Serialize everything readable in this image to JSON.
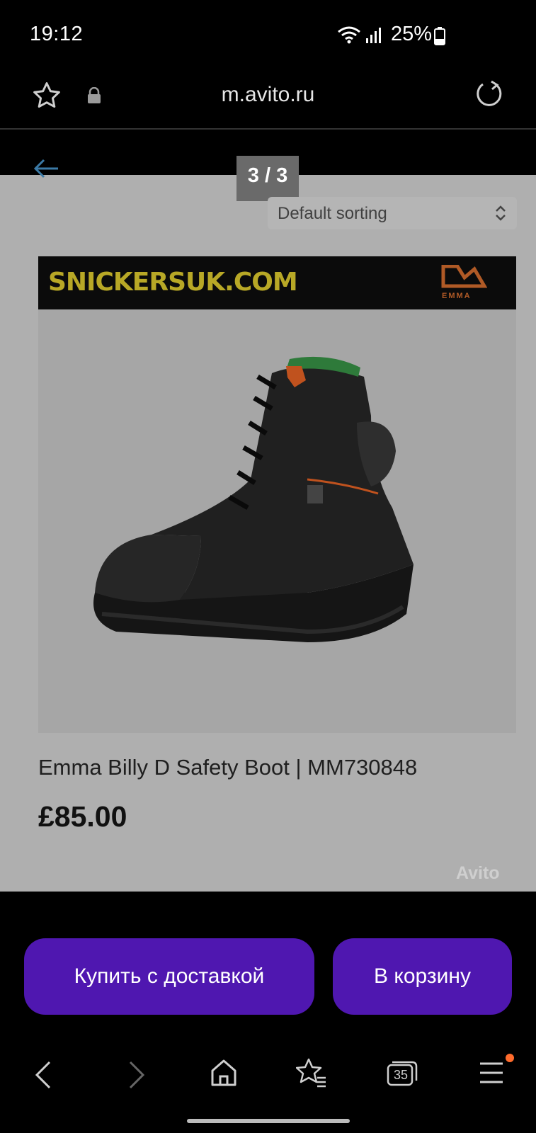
{
  "status": {
    "time": "19:12",
    "battery": "25%"
  },
  "browser": {
    "url": "m.avito.ru"
  },
  "gallery": {
    "counter": "3 / 3"
  },
  "sort": {
    "label": "Default sorting"
  },
  "banner": {
    "brand": "SNICKERSUK.COM",
    "logo_text": "EMMA"
  },
  "product": {
    "title": "Emma Billy D Safety Boot | MM730848",
    "price": "£85.00",
    "watermark": "Avito"
  },
  "actions": {
    "buy": "Купить с доставкой",
    "cart": "В корзину"
  },
  "nav": {
    "tabs_count": "35"
  },
  "colors": {
    "accent": "#4f17b0",
    "notification": "#ff6b2c"
  }
}
